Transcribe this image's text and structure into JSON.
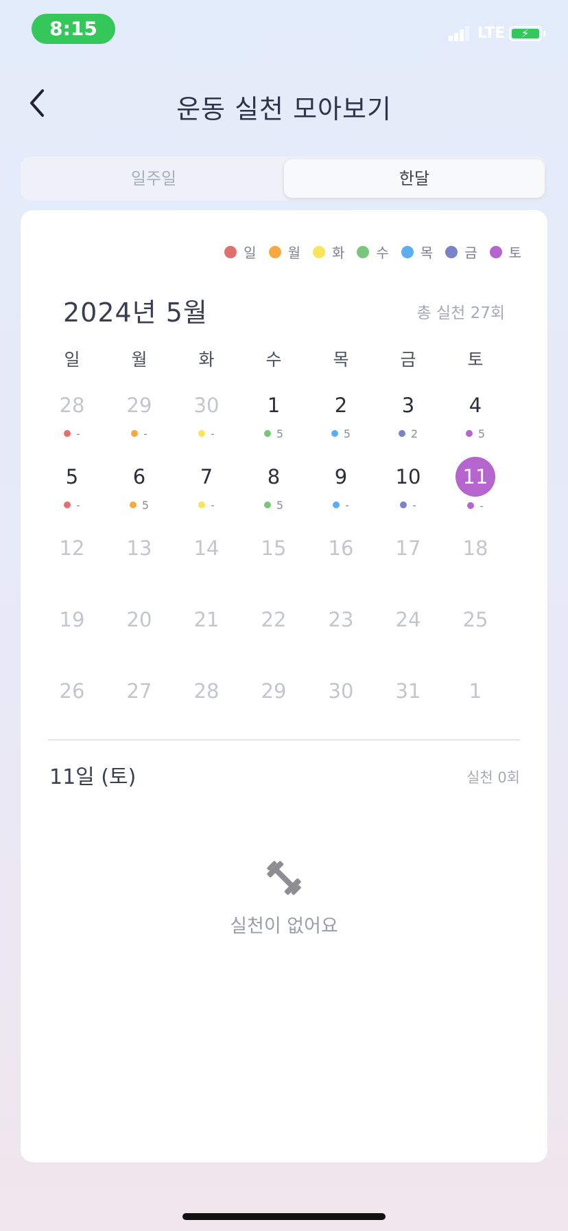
{
  "status_bar": {
    "time": "8:15",
    "network": "LTE",
    "accent_color": "#34c759"
  },
  "header": {
    "title": "운동 실천 모아보기",
    "back_icon": "chevron-left-icon"
  },
  "tabs": [
    {
      "label": "일주일",
      "selected": false
    },
    {
      "label": "한달",
      "selected": true
    }
  ],
  "legend": [
    {
      "label": "일",
      "color": "#e46f6f"
    },
    {
      "label": "월",
      "color": "#f7a940"
    },
    {
      "label": "화",
      "color": "#f9e45a"
    },
    {
      "label": "수",
      "color": "#78c57e"
    },
    {
      "label": "목",
      "color": "#5baef0"
    },
    {
      "label": "금",
      "color": "#7a82c8"
    },
    {
      "label": "토",
      "color": "#b665cf"
    }
  ],
  "calendar": {
    "month_title": "2024년 5월",
    "total": "총 실천 27회",
    "weekdays": [
      "일",
      "월",
      "화",
      "수",
      "목",
      "금",
      "토"
    ],
    "weeks": [
      [
        {
          "day": "28",
          "count": "-",
          "faded": true,
          "dot": true
        },
        {
          "day": "29",
          "count": "-",
          "faded": true,
          "dot": true
        },
        {
          "day": "30",
          "count": "-",
          "faded": true,
          "dot": true
        },
        {
          "day": "1",
          "count": "5",
          "faded": false,
          "dot": true
        },
        {
          "day": "2",
          "count": "5",
          "faded": false,
          "dot": true
        },
        {
          "day": "3",
          "count": "2",
          "faded": false,
          "dot": true
        },
        {
          "day": "4",
          "count": "5",
          "faded": false,
          "dot": true
        }
      ],
      [
        {
          "day": "5",
          "count": "-",
          "faded": false,
          "dot": true
        },
        {
          "day": "6",
          "count": "5",
          "faded": false,
          "dot": true
        },
        {
          "day": "7",
          "count": "-",
          "faded": false,
          "dot": true
        },
        {
          "day": "8",
          "count": "5",
          "faded": false,
          "dot": true
        },
        {
          "day": "9",
          "count": "-",
          "faded": false,
          "dot": true
        },
        {
          "day": "10",
          "count": "-",
          "faded": false,
          "dot": true
        },
        {
          "day": "11",
          "count": "-",
          "faded": false,
          "dot": true,
          "selected": true
        }
      ],
      [
        {
          "day": "12",
          "faded": true
        },
        {
          "day": "13",
          "faded": true
        },
        {
          "day": "14",
          "faded": true
        },
        {
          "day": "15",
          "faded": true
        },
        {
          "day": "16",
          "faded": true
        },
        {
          "day": "17",
          "faded": true
        },
        {
          "day": "18",
          "faded": true
        }
      ],
      [
        {
          "day": "19",
          "faded": true
        },
        {
          "day": "20",
          "faded": true
        },
        {
          "day": "21",
          "faded": true
        },
        {
          "day": "22",
          "faded": true
        },
        {
          "day": "23",
          "faded": true
        },
        {
          "day": "24",
          "faded": true
        },
        {
          "day": "25",
          "faded": true
        }
      ],
      [
        {
          "day": "26",
          "faded": true
        },
        {
          "day": "27",
          "faded": true
        },
        {
          "day": "28",
          "faded": true
        },
        {
          "day": "29",
          "faded": true
        },
        {
          "day": "30",
          "faded": true
        },
        {
          "day": "31",
          "faded": true
        },
        {
          "day": "1",
          "faded": true
        }
      ]
    ]
  },
  "selected_day": {
    "date": "11일 (토)",
    "count": "실천 0회",
    "empty_icon": "dumbbell-icon",
    "empty_text": "실천이 없어요"
  }
}
